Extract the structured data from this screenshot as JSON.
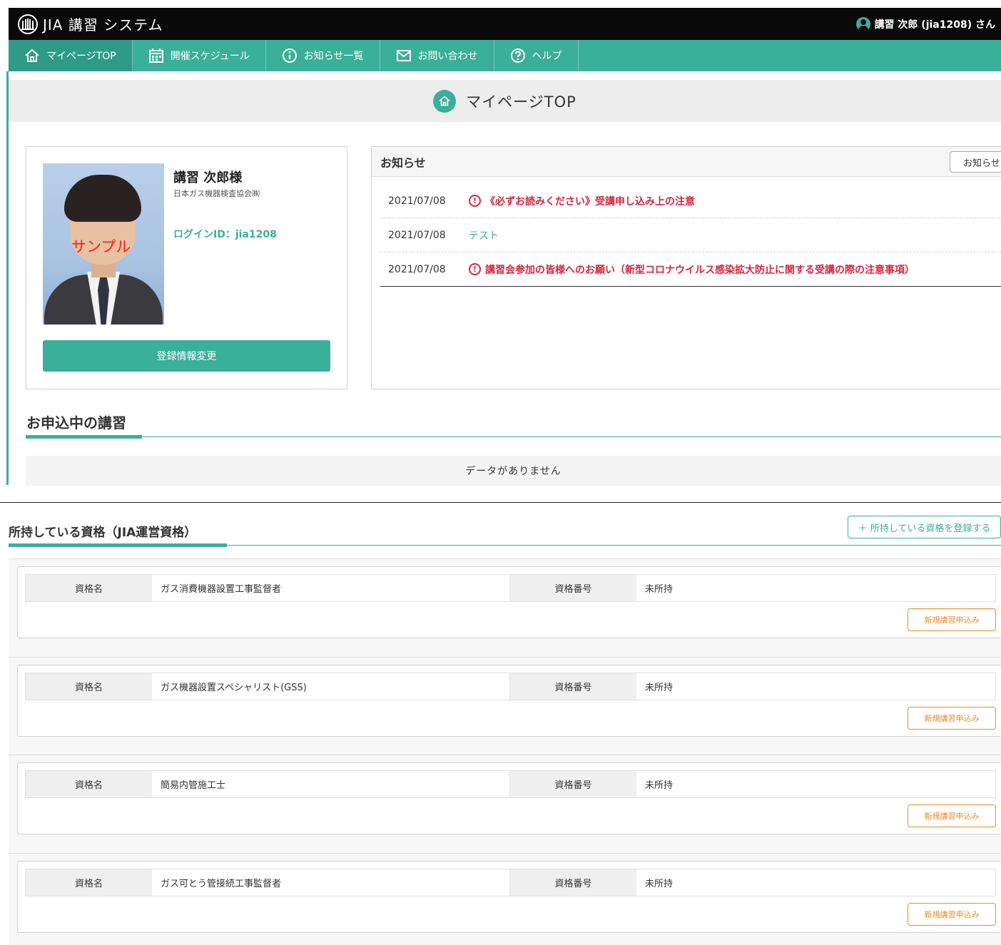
{
  "header": {
    "logo_text": "JIA 講習 システム",
    "user_label": "講習 次郎 (jia1208) さん"
  },
  "nav": {
    "items": [
      {
        "label": "マイページTOP",
        "icon": "home-icon",
        "active": true
      },
      {
        "label": "開催スケジュール",
        "icon": "calendar-icon",
        "active": false
      },
      {
        "label": "お知らせ一覧",
        "icon": "info-icon",
        "active": false
      },
      {
        "label": "お問い合わせ",
        "icon": "mail-icon",
        "active": false
      },
      {
        "label": "ヘルプ",
        "icon": "help-icon",
        "active": false
      }
    ]
  },
  "page_title": "マイページTOP",
  "profile": {
    "name": "講習 次郎様",
    "organization": "日本ガス機器検査協会㈱",
    "login_id": "ログインID：jia1208",
    "photo_watermark": "サンプル",
    "edit_button": "登録情報変更"
  },
  "news": {
    "heading": "お知らせ",
    "more_button": "お知らせ",
    "items": [
      {
        "date": "2021/07/08",
        "title": "《必ずお読みください》受講申し込み上の注意",
        "important": true
      },
      {
        "date": "2021/07/08",
        "title": "テスト",
        "important": false
      },
      {
        "date": "2021/07/08",
        "title": "講習会参加の皆様へのお願い（新型コロナウイルス感染拡大防止に関する受講の際の注意事項）",
        "important": true
      }
    ]
  },
  "applications": {
    "heading": "お申込中の講習",
    "empty_text": "データがありません"
  },
  "qualifications": {
    "heading": "所持している資格（JIA運営資格）",
    "add_button": "＋ 所持している資格を登録する",
    "name_label": "資格名",
    "number_label": "資格番号",
    "apply_button": "新規講習申込み",
    "items": [
      {
        "name": "ガス消費機器設置工事監督者",
        "number": "未所持"
      },
      {
        "name": "ガス機器設置スペシャリスト(GSS)",
        "number": "未所持"
      },
      {
        "name": "簡易内管施工士",
        "number": "未所持"
      },
      {
        "name": "ガス可とう管接続工事監督者",
        "number": "未所持"
      }
    ]
  },
  "colors": {
    "accent": "#3aaf9a",
    "alert": "#d7263d",
    "apply": "#ef8a2a",
    "header_bg": "#0a0a0a"
  }
}
